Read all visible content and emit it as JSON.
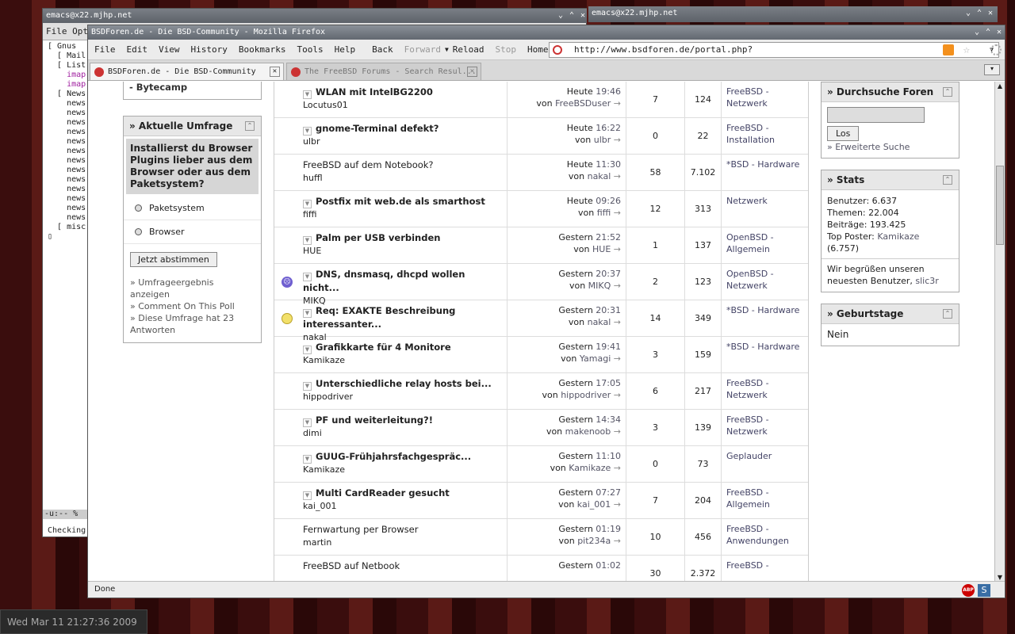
{
  "emacs_back": {
    "title": "emacs@x22.mjhp.net",
    "menu": "File  Opt",
    "lines": [
      {
        "t": "[ Gnus",
        "link": false
      },
      {
        "t": "  [ Mail",
        "link": false
      },
      {
        "t": "  [ List",
        "link": false
      },
      {
        "t": "    imap.",
        "link": true
      },
      {
        "t": "    imap.",
        "link": true
      },
      {
        "t": "  [ News",
        "link": false
      },
      {
        "t": "    news.",
        "link": false
      },
      {
        "t": "    news.",
        "link": false
      },
      {
        "t": "    news.",
        "link": false
      },
      {
        "t": "    news.",
        "link": false
      },
      {
        "t": "    news.",
        "link": false
      },
      {
        "t": "    news.",
        "link": false
      },
      {
        "t": "    news.",
        "link": false
      },
      {
        "t": "    news.",
        "link": false
      },
      {
        "t": "    news.",
        "link": false
      },
      {
        "t": "    news.",
        "link": false
      },
      {
        "t": "    news.",
        "link": false
      },
      {
        "t": "    news.",
        "link": false
      },
      {
        "t": "    news.",
        "link": false
      },
      {
        "t": "  [ misc",
        "link": false
      },
      {
        "t": "▯",
        "link": false
      }
    ],
    "modeline": "-u:--  %",
    "echo": "Checking"
  },
  "emacs_top": {
    "title": "emacs@x22.mjhp.net"
  },
  "firefox": {
    "title": "BSDForen.de - Die BSD-Community - Mozilla Firefox",
    "menus": [
      "File",
      "Edit",
      "View",
      "History",
      "Bookmarks",
      "Tools",
      "Help"
    ],
    "nav": {
      "back": "Back",
      "forward": "Forward",
      "reload": "Reload",
      "stop": "Stop",
      "home": "Home"
    },
    "url": "http://www.bsdforen.de/portal.php?",
    "tabs": [
      {
        "label": "BSDForen.de - Die BSD-Community"
      },
      {
        "label": "The FreeBSD Forums - Search Resul..."
      }
    ],
    "status": "Done",
    "abp": "ABP",
    "s_icon": "S"
  },
  "left": {
    "bytecamp": "- Bytecamp",
    "poll_title": "» Aktuelle Umfrage",
    "question": "Installierst du Browser Plugins lieber aus dem Browser oder aus dem Paketsystem?",
    "options": [
      "Paketsystem",
      "Browser"
    ],
    "vote": "Jetzt abstimmen",
    "links": [
      "» Umfrageergebnis anzeigen",
      "» Comment On This Poll",
      "» Diese Umfrage hat 23 Antworten"
    ]
  },
  "topics": [
    {
      "title": "WLAN mit IntelBG2200",
      "author": "Locutus01",
      "bold": true,
      "icon": "",
      "day": "Heute",
      "time": "19:46",
      "by": "FreeBSDuser",
      "replies": "7",
      "views": "124",
      "forum": "FreeBSD - Netzwerk"
    },
    {
      "title": "gnome-Terminal defekt?",
      "author": "ulbr",
      "bold": true,
      "icon": "",
      "day": "Heute",
      "time": "16:22",
      "by": "ulbr",
      "replies": "0",
      "views": "22",
      "forum": "FreeBSD - Installation"
    },
    {
      "title": "FreeBSD auf dem Notebook?",
      "author": "huffl",
      "bold": false,
      "icon": "",
      "day": "Heute",
      "time": "11:30",
      "by": "nakal",
      "replies": "58",
      "views": "7.102",
      "forum": "*BSD - Hardware"
    },
    {
      "title": "Postfix mit web.de als smarthost",
      "author": "fiffi",
      "bold": true,
      "icon": "",
      "day": "Heute",
      "time": "09:26",
      "by": "fiffi",
      "replies": "12",
      "views": "313",
      "forum": "Netzwerk"
    },
    {
      "title": "Palm per USB verbinden",
      "author": "HUE",
      "bold": true,
      "icon": "",
      "day": "Gestern",
      "time": "21:52",
      "by": "HUE",
      "replies": "1",
      "views": "137",
      "forum": "OpenBSD - Allgemein"
    },
    {
      "title": "DNS, dnsmasq, dhcpd wollen nicht...",
      "author": "MIKQ",
      "bold": true,
      "icon": "sad",
      "day": "Gestern",
      "time": "20:37",
      "by": "MIKQ",
      "replies": "2",
      "views": "123",
      "forum": "OpenBSD - Netzwerk"
    },
    {
      "title": "Req: EXAKTE Beschreibung interessanter...",
      "author": "nakal",
      "bold": true,
      "icon": "bulb",
      "day": "Gestern",
      "time": "20:31",
      "by": "nakal",
      "replies": "14",
      "views": "349",
      "forum": "*BSD - Hardware"
    },
    {
      "title": "Grafikkarte für 4 Monitore",
      "author": "Kamikaze",
      "bold": true,
      "icon": "",
      "day": "Gestern",
      "time": "19:41",
      "by": "Yamagi",
      "replies": "3",
      "views": "159",
      "forum": "*BSD - Hardware"
    },
    {
      "title": "Unterschiedliche relay hosts bei...",
      "author": "hippodriver",
      "bold": true,
      "icon": "",
      "day": "Gestern",
      "time": "17:05",
      "by": "hippodriver",
      "replies": "6",
      "views": "217",
      "forum": "FreeBSD - Netzwerk"
    },
    {
      "title": "PF und weiterleitung?!",
      "author": "dimi",
      "bold": true,
      "icon": "",
      "day": "Gestern",
      "time": "14:34",
      "by": "makenoob",
      "replies": "3",
      "views": "139",
      "forum": "FreeBSD - Netzwerk"
    },
    {
      "title": "GUUG-Frühjahrsfachgespräc...",
      "author": "Kamikaze",
      "bold": true,
      "icon": "",
      "day": "Gestern",
      "time": "11:10",
      "by": "Kamikaze",
      "replies": "0",
      "views": "73",
      "forum": "Geplauder"
    },
    {
      "title": "Multi CardReader gesucht",
      "author": "kai_001",
      "bold": true,
      "icon": "",
      "day": "Gestern",
      "time": "07:27",
      "by": "kai_001",
      "replies": "7",
      "views": "204",
      "forum": "FreeBSD - Allgemein"
    },
    {
      "title": "Fernwartung per Browser",
      "author": "martin",
      "bold": false,
      "icon": "",
      "day": "Gestern",
      "time": "01:19",
      "by": "pit234a",
      "replies": "10",
      "views": "456",
      "forum": "FreeBSD - Anwendungen"
    },
    {
      "title": "FreeBSD auf Netbook",
      "author": "",
      "bold": false,
      "icon": "",
      "day": "Gestern",
      "time": "01:02",
      "by": "",
      "replies": "30",
      "views": "2.372",
      "forum": "FreeBSD -"
    }
  ],
  "von": "von",
  "right": {
    "search_title": "» Durchsuche Foren",
    "search_btn": "Los",
    "adv": "» Erweiterte Suche",
    "stats_title": "» Stats",
    "stats": [
      "Benutzer: 6.637",
      "Themen: 22.004",
      "Beiträge: 193.425"
    ],
    "top_label": "Top Poster: ",
    "top_user": "Kamikaze",
    "top_count": "(6.757)",
    "welcome": "Wir begrüßen unseren neuesten Benutzer, ",
    "newest": "slic3r",
    "bday_title": "» Geburtstage",
    "bday_text": "Nein"
  },
  "clock": "Wed Mar 11 21:27:36 2009"
}
